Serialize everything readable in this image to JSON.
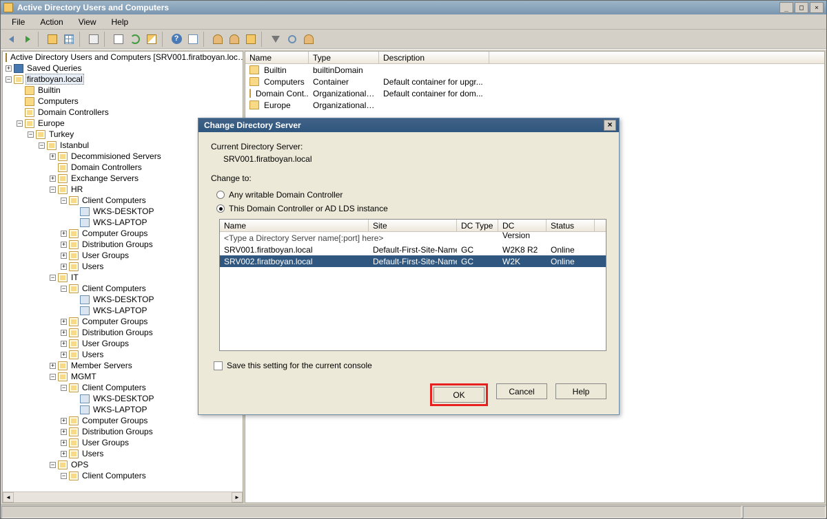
{
  "window": {
    "title": "Active Directory Users and Computers",
    "root_label": "Active Directory Users and Computers [SRV001.firatboyan.loc…"
  },
  "menu": {
    "file": "File",
    "action": "Action",
    "view": "View",
    "help": "Help"
  },
  "tree": {
    "saved_queries": "Saved Queries",
    "domain": "firatboyan.local",
    "builtin": "Builtin",
    "computers": "Computers",
    "domain_controllers": "Domain Controllers",
    "europe": "Europe",
    "turkey": "Turkey",
    "istanbul": "Istanbul",
    "decom": "Decommisioned Servers",
    "dc": "Domain Controllers",
    "exch": "Exchange Servers",
    "hr": "HR",
    "client_computers": "Client Computers",
    "wks_desktop": "WKS-DESKTOP",
    "wks_laptop": "WKS-LAPTOP",
    "computer_groups": "Computer Groups",
    "dist_groups": "Distribution Groups",
    "user_groups": "User Groups",
    "users": "Users",
    "it": "IT",
    "member_servers": "Member Servers",
    "mgmt": "MGMT",
    "ops": "OPS"
  },
  "list": {
    "headers": {
      "name": "Name",
      "type": "Type",
      "desc": "Description"
    },
    "rows": [
      {
        "name": "Builtin",
        "type": "builtinDomain",
        "desc": ""
      },
      {
        "name": "Computers",
        "type": "Container",
        "desc": "Default container for upgr..."
      },
      {
        "name": "Domain Cont...",
        "type": "Organizational ...",
        "desc": "Default container for dom..."
      },
      {
        "name": "Europe",
        "type": "Organizational ...",
        "desc": ""
      }
    ]
  },
  "dialog": {
    "title": "Change Directory Server",
    "current_label": "Current Directory Server:",
    "current_value": "SRV001.firatboyan.local",
    "change_to": "Change to:",
    "opt_any": "Any writable Domain Controller",
    "opt_this": "This Domain Controller or AD LDS instance",
    "cols": {
      "name": "Name",
      "site": "Site",
      "dctype": "DC Type",
      "dcver": "DC Version",
      "status": "Status"
    },
    "placeholder": "<Type a Directory Server name[:port] here>",
    "rows": [
      {
        "name": "SRV001.firatboyan.local",
        "site": "Default-First-Site-Name",
        "dctype": "GC",
        "dcver": "W2K8 R2",
        "status": "Online",
        "selected": false
      },
      {
        "name": "SRV002.firatboyan.local",
        "site": "Default-First-Site-Name",
        "dctype": "GC",
        "dcver": "W2K",
        "status": "Online",
        "selected": true
      }
    ],
    "save_setting": "Save this setting for the current console",
    "ok": "OK",
    "cancel": "Cancel",
    "help": "Help"
  }
}
